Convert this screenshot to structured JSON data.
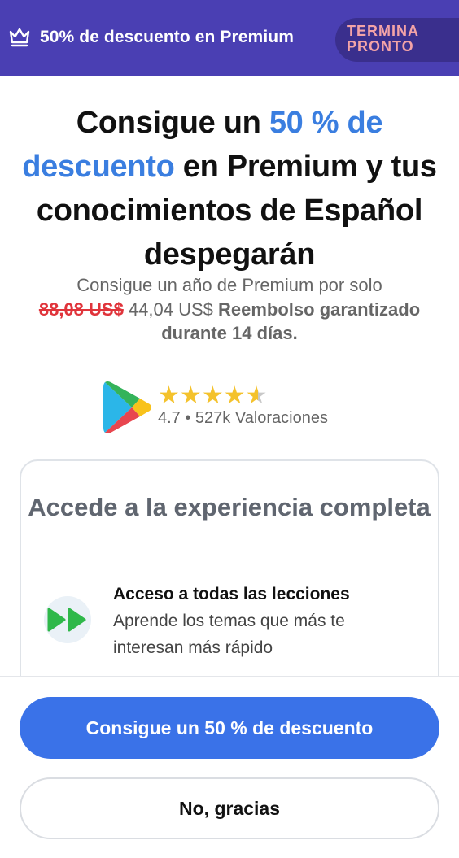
{
  "banner": {
    "text": "50% de descuento en Premium",
    "badge_line1": "TERMINA",
    "badge_line2": "PRONTO",
    "icon": "crown-icon"
  },
  "headline": {
    "part1": "Consigue un ",
    "highlight1": "50 % de",
    "highlight2": "descuento",
    "part2": " en Premium y tus conocimientos de Español despegarán"
  },
  "subtitle": {
    "intro": "Consigue un año de Premium por solo",
    "old_price": "88,08 US$",
    "new_price": " 44,04 US$ ",
    "guarantee": "Reembolso garantizado durante 14 días."
  },
  "rating": {
    "store_icon": "google-play-icon",
    "stars": 4.7,
    "text": "4.7 • 527k Valoraciones"
  },
  "card": {
    "title": "Accede a la experiencia completa",
    "feature": {
      "icon": "fast-forward-icon",
      "title": "Acceso a todas las lecciones",
      "description": "Aprende los temas que más te interesan más rápido"
    }
  },
  "buttons": {
    "primary": "Consigue un 50 % de descuento",
    "secondary": "No, gracias"
  },
  "colors": {
    "banner": "#4a3fb3",
    "accent": "#3a7ee0",
    "primary_button": "#3a72e8",
    "badge_text": "#f3a3a7",
    "old_price": "#e0343b",
    "stars": "#f4c22c"
  }
}
